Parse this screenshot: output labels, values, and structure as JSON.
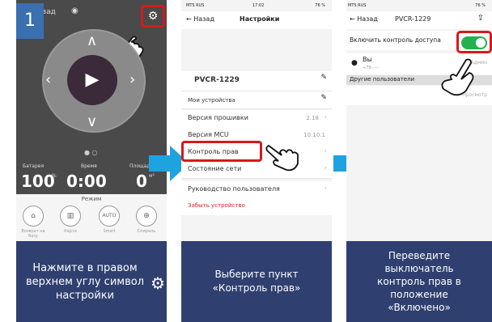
{
  "panel1": {
    "step_number": "1",
    "back_label": "Назад",
    "stats": [
      {
        "label": "Батарея",
        "value": "100",
        "unit": "%"
      },
      {
        "label": "Время",
        "value": "0:00",
        "unit": ""
      },
      {
        "label": "Площадь",
        "value": "0",
        "unit": "м²"
      }
    ],
    "modes_title": "Режим",
    "modes": [
      {
        "label": "Возврат на базу",
        "icon": "home-icon"
      },
      {
        "label": "Карта",
        "icon": "map-icon"
      },
      {
        "label": "Smart",
        "icon": "auto-icon"
      },
      {
        "label": "Спираль",
        "icon": "spiral-icon"
      }
    ],
    "auto_text": "AUTO",
    "caption": "Нажмите в правом верхнем углу символ настройки"
  },
  "panel2": {
    "status_carrier": "MTS RUS",
    "status_time": "17:02",
    "status_battery": "76 %",
    "back_label": "Назад",
    "title": "Настройки",
    "device_name": "PVCR-1229",
    "rows": [
      {
        "label": "Мои устройства",
        "value": ""
      },
      {
        "label": "Версия прошивки",
        "value": "2.18"
      },
      {
        "label": "Версия MCU",
        "value": "10.10.1"
      },
      {
        "label": "Контроль прав",
        "value": ""
      },
      {
        "label": "Состояние сети",
        "value": ""
      },
      {
        "label": "Руководство пользователя",
        "value": ""
      }
    ],
    "forget_label": "Забыть устройство",
    "caption": "Выберите пункт «Контроль прав»"
  },
  "panel3": {
    "status_carrier": "MTS RUS",
    "status_battery": "76 %",
    "back_label": "Назад",
    "title": "PVCR-1229",
    "enable_label": "Включить контроль доступа",
    "me_name": "Вы",
    "me_phone": "+79······",
    "me_role": "Админ",
    "others_header": "Другие пользователи",
    "other_role": "Просмотр",
    "caption": "Переведите выключатель контроль прав в положение «Включено»"
  },
  "colors": {
    "caption_bg": "#2f3f6f",
    "highlight": "#d51a1a",
    "arrow": "#1fa3e0",
    "toggle_on": "#22b14c"
  }
}
